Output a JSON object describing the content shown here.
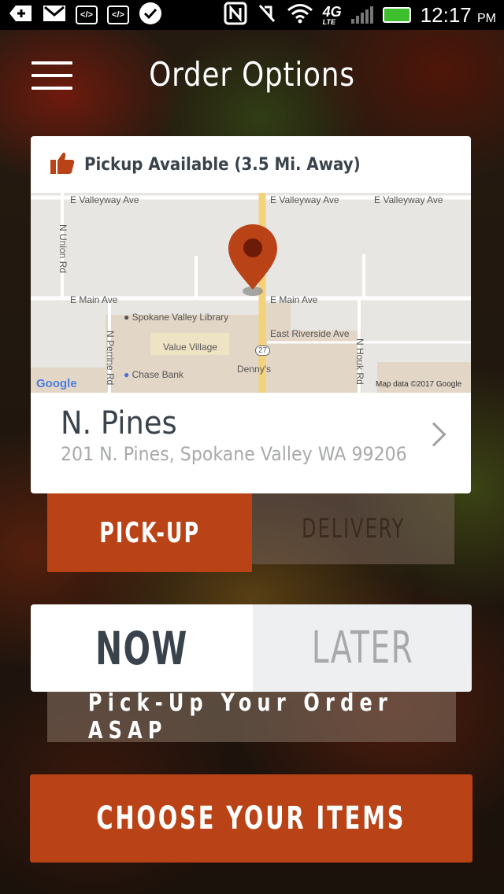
{
  "status_bar": {
    "time": "12:17",
    "ampm": "PM",
    "network": "4G",
    "network_sub": "LTE"
  },
  "header": {
    "title": "Order Options"
  },
  "location_card": {
    "availability": "Pickup Available (3.5 Mi. Away)",
    "store_name": "N. Pines",
    "store_address": "201 N. Pines, Spokane Valley WA 99206",
    "map": {
      "streets": [
        "E Valleyway Ave",
        "E Valleyway Ave",
        "E Valleyway Ave",
        "E Main Ave",
        "E Main Ave",
        "East Riverside Ave",
        "N Union Rd",
        "N Perrine Rd",
        "N Houk Rd"
      ],
      "places": [
        "Spokane Valley Library",
        "Value Village",
        "Chase Bank",
        "Denny's"
      ],
      "route_badge": "27",
      "brand": "Google",
      "attribution": "Map data ©2017 Google"
    }
  },
  "fulfillment": {
    "pickup_label": "PICK-UP",
    "delivery_label": "DELIVERY",
    "selected": "pickup"
  },
  "timing": {
    "now_label": "NOW",
    "later_label": "LATER",
    "selected": "now",
    "note": "Pick-Up Your Order ASAP"
  },
  "cta": {
    "label": "CHOOSE YOUR ITEMS"
  },
  "colors": {
    "accent": "#b94316",
    "text_dark": "#3a434b",
    "text_muted": "#a7a9ab",
    "map_road_highlight": "#f3d27a"
  }
}
